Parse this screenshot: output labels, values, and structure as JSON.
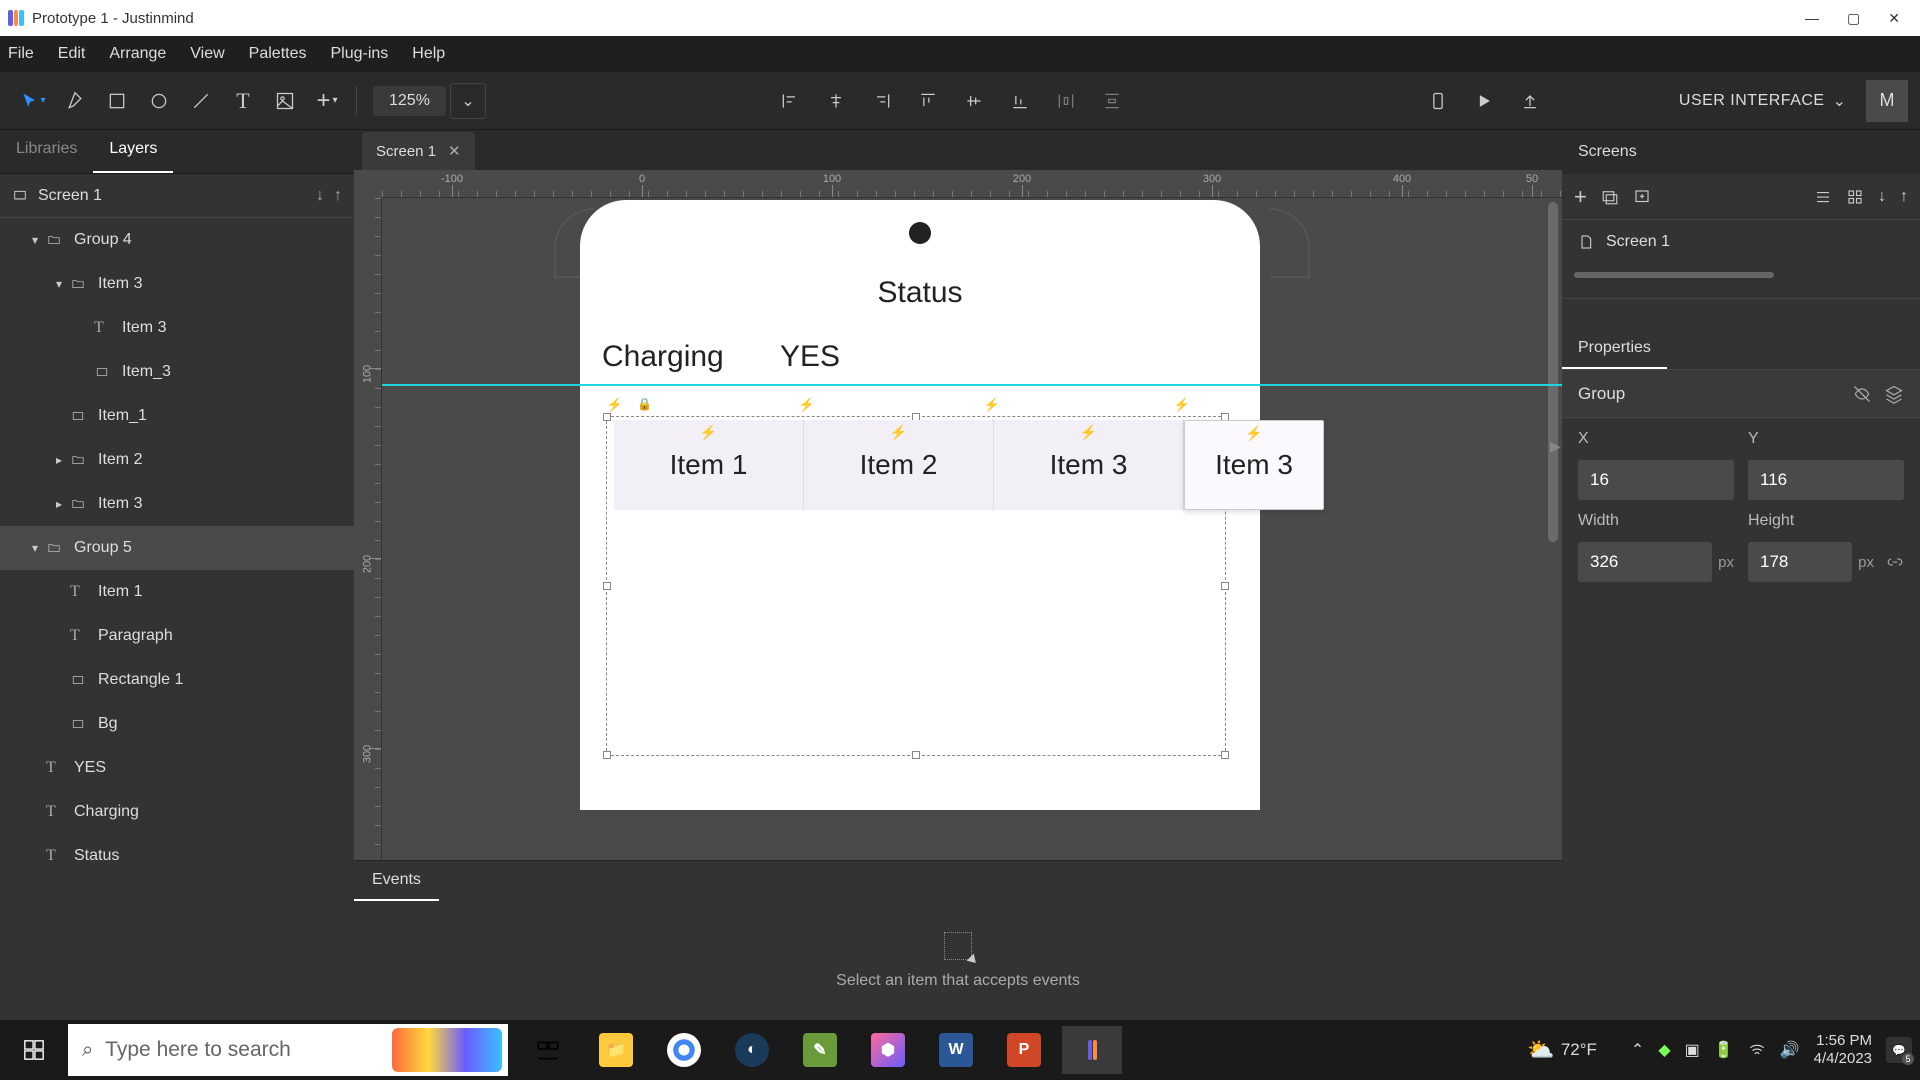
{
  "window": {
    "title": "Prototype 1 - Justinmind"
  },
  "menu": [
    "File",
    "Edit",
    "Arrange",
    "View",
    "Palettes",
    "Plug-ins",
    "Help"
  ],
  "zoom": "125%",
  "ui_mode": {
    "label": "USER INTERFACE",
    "avatar": "M"
  },
  "left": {
    "tabs": [
      "Libraries",
      "Layers"
    ],
    "active_tab": 1,
    "screen": "Screen 1",
    "tree": [
      {
        "indent": 1,
        "chev": "▾",
        "icon": "folder",
        "label": "Group 4"
      },
      {
        "indent": 2,
        "chev": "▾",
        "icon": "folder",
        "label": "Item 3"
      },
      {
        "indent": 3,
        "chev": "",
        "icon": "text",
        "label": "Item 3"
      },
      {
        "indent": 3,
        "chev": "",
        "icon": "rect",
        "label": "Item_3"
      },
      {
        "indent": 2,
        "chev": "",
        "icon": "rect",
        "label": "Item_1"
      },
      {
        "indent": 2,
        "chev": "▸",
        "icon": "folder",
        "label": "Item 2"
      },
      {
        "indent": 2,
        "chev": "▸",
        "icon": "folder",
        "label": "Item 3"
      },
      {
        "indent": 1,
        "chev": "▾",
        "icon": "folder",
        "label": "Group 5",
        "selected": true
      },
      {
        "indent": 2,
        "chev": "",
        "icon": "text",
        "label": "Item 1"
      },
      {
        "indent": 2,
        "chev": "",
        "icon": "text",
        "label": "Paragraph"
      },
      {
        "indent": 2,
        "chev": "",
        "icon": "rect",
        "label": "Rectangle 1"
      },
      {
        "indent": 2,
        "chev": "",
        "icon": "rect",
        "label": "Bg"
      },
      {
        "indent": 1,
        "chev": "",
        "icon": "text",
        "label": "YES"
      },
      {
        "indent": 1,
        "chev": "",
        "icon": "text",
        "label": "Charging"
      },
      {
        "indent": 1,
        "chev": "",
        "icon": "text",
        "label": "Status"
      }
    ]
  },
  "canvas": {
    "tab": "Screen 1",
    "ruler_h": [
      "-100",
      "0",
      "100",
      "200",
      "300",
      "400",
      "50"
    ],
    "ruler_v": [
      "100",
      "200",
      "300"
    ],
    "status": "Status",
    "charging": "Charging",
    "yes": "YES",
    "items": [
      "Item 1",
      "Item 2",
      "Item 3",
      "Item 3"
    ]
  },
  "events": {
    "tab": "Events",
    "hint": "Select an item that accepts events"
  },
  "right": {
    "screens_tab": "Screens",
    "screen_item": "Screen 1",
    "props_tab": "Properties",
    "type": "Group",
    "x_label": "X",
    "x": "16",
    "y_label": "Y",
    "y": "116",
    "w_label": "Width",
    "w": "326",
    "w_unit": "px",
    "h_label": "Height",
    "h": "178",
    "h_unit": "px"
  },
  "taskbar": {
    "search_placeholder": "Type here to search",
    "temp": "72°F",
    "time": "1:56 PM",
    "date": "4/4/2023"
  }
}
